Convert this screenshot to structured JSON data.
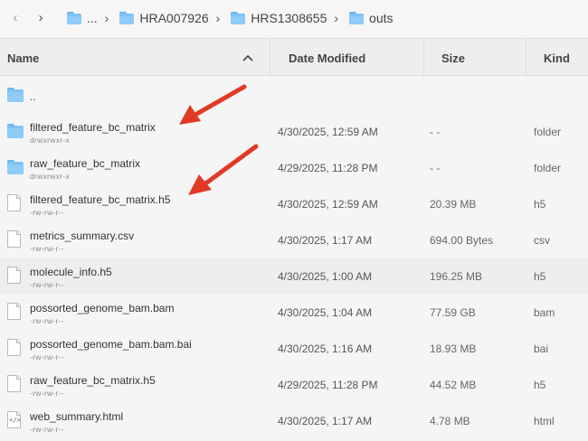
{
  "breadcrumb": {
    "ellipsis": "...",
    "items": [
      "HRA007926",
      "HRS1308655",
      "outs"
    ]
  },
  "header": {
    "name": "Name",
    "date": "Date Modified",
    "size": "Size",
    "kind": "Kind"
  },
  "files": [
    {
      "name": "..",
      "perm": "",
      "date": "",
      "size": "",
      "kind": "",
      "icon": "folder-icon"
    },
    {
      "name": "filtered_feature_bc_matrix",
      "perm": "drwxrwxr-x",
      "date": "4/30/2025, 12:59 AM",
      "size": "- -",
      "kind": "folder",
      "icon": "folder-icon"
    },
    {
      "name": "raw_feature_bc_matrix",
      "perm": "drwxrwxr-x",
      "date": "4/29/2025, 11:28 PM",
      "size": "- -",
      "kind": "folder",
      "icon": "folder-icon"
    },
    {
      "name": "filtered_feature_bc_matrix.h5",
      "perm": "-rw-rw-r--",
      "date": "4/30/2025, 12:59 AM",
      "size": "20.39 MB",
      "kind": "h5",
      "icon": "file-icon"
    },
    {
      "name": "metrics_summary.csv",
      "perm": "-rw-rw-r--",
      "date": "4/30/2025, 1:17 AM",
      "size": "694.00 Bytes",
      "kind": "csv",
      "icon": "file-icon"
    },
    {
      "name": "molecule_info.h5",
      "perm": "-rw-rw-r--",
      "date": "4/30/2025, 1:00 AM",
      "size": "196.25 MB",
      "kind": "h5",
      "icon": "file-icon"
    },
    {
      "name": "possorted_genome_bam.bam",
      "perm": "-rw-rw-r--",
      "date": "4/30/2025, 1:04 AM",
      "size": "77.59 GB",
      "kind": "bam",
      "icon": "file-icon"
    },
    {
      "name": "possorted_genome_bam.bam.bai",
      "perm": "-rw-rw-r--",
      "date": "4/30/2025, 1:16 AM",
      "size": "18.93 MB",
      "kind": "bai",
      "icon": "file-icon"
    },
    {
      "name": "raw_feature_bc_matrix.h5",
      "perm": "-rw-rw-r--",
      "date": "4/29/2025, 11:28 PM",
      "size": "44.52 MB",
      "kind": "h5",
      "icon": "file-icon"
    },
    {
      "name": "web_summary.html",
      "perm": "-rw-rw-r--",
      "date": "4/30/2025, 1:17 AM",
      "size": "4.78 MB",
      "kind": "html",
      "icon": "html-file-icon"
    }
  ],
  "colors": {
    "folder": "#7fc3f5",
    "arrow": "#e03a26"
  }
}
